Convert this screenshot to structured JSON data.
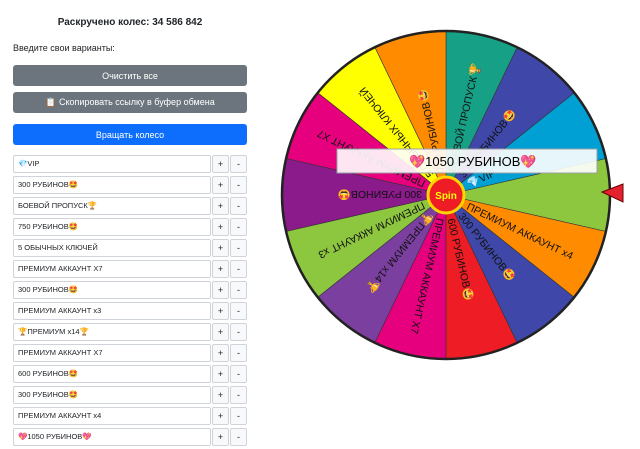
{
  "counter": "Раскручено колес: 34 586 842",
  "prompt": "Введите свои варианты:",
  "buttons": {
    "clear": "Очистить все",
    "copy": "📋 Скопировать ссылку в буфер обмена",
    "spin": "Вращать колесо"
  },
  "items": [
    "💎VIP",
    "300 РУБИНОВ🤩",
    "БОЕВОЙ ПРОПУСК🏆",
    "750 РУБИНОВ🤩",
    "5 ОБЫЧНЫХ КЛЮЧЕЙ",
    "ПРЕМИУМ АККАУНТ X7",
    "300 РУБИНОВ🤩",
    "ПРЕМИУМ АККАУНТ x3",
    "🏆ПРЕМИУМ x14🏆",
    "ПРЕМИУМ АККАУНТ X7",
    "600 РУБИНОВ🤩",
    "300 РУБИНОВ🤩",
    "ПРЕМИУМ АККАУНТ x4",
    "💖1050 РУБИНОВ💖"
  ],
  "plus": "+",
  "minus": "-",
  "wheel": {
    "center_label": "Spin",
    "result_label": "💖1050 РУБИНОВ💖",
    "segments": [
      {
        "text": "💖1050 РУБИНОВ💖",
        "color": "#8dc63f"
      },
      {
        "text": "💎VIP",
        "color": "#009fd4"
      },
      {
        "text": "300 РУБИНОВ🤩",
        "color": "#3f48a8"
      },
      {
        "text": "БОЕВОЙ ПРОПУСК🏆",
        "color": "#16a085"
      },
      {
        "text": "750 РУБИНОВ🤩",
        "color": "#ff8c00"
      },
      {
        "text": "5 ОБЫЧНЫХ КЛЮЧЕЙ",
        "color": "#ffff00"
      },
      {
        "text": "ПРЕМИУМ АККАУНТ X7",
        "color": "#e6007e"
      },
      {
        "text": "300 РУБИНОВ🤩",
        "color": "#8b1a8b"
      },
      {
        "text": "ПРЕМИУМ АККАУНТ x3",
        "color": "#8dc63f"
      },
      {
        "text": "🏆ПРЕМИУМ x14🏆",
        "color": "#7b3fa0"
      },
      {
        "text": "ПРЕМИУМ АККАУНТ X7",
        "color": "#e6007e"
      },
      {
        "text": "600 РУБИНОВ🤩",
        "color": "#ee1c25"
      },
      {
        "text": "300 РУБИНОВ🤩",
        "color": "#3f48a8"
      },
      {
        "text": "ПРЕМИУМ АККАУНТ x4",
        "color": "#ff8c00"
      }
    ]
  },
  "colors": {
    "pointer": "#e4222e",
    "hub": "#ee1c25",
    "hub_text": "#ffff00"
  }
}
